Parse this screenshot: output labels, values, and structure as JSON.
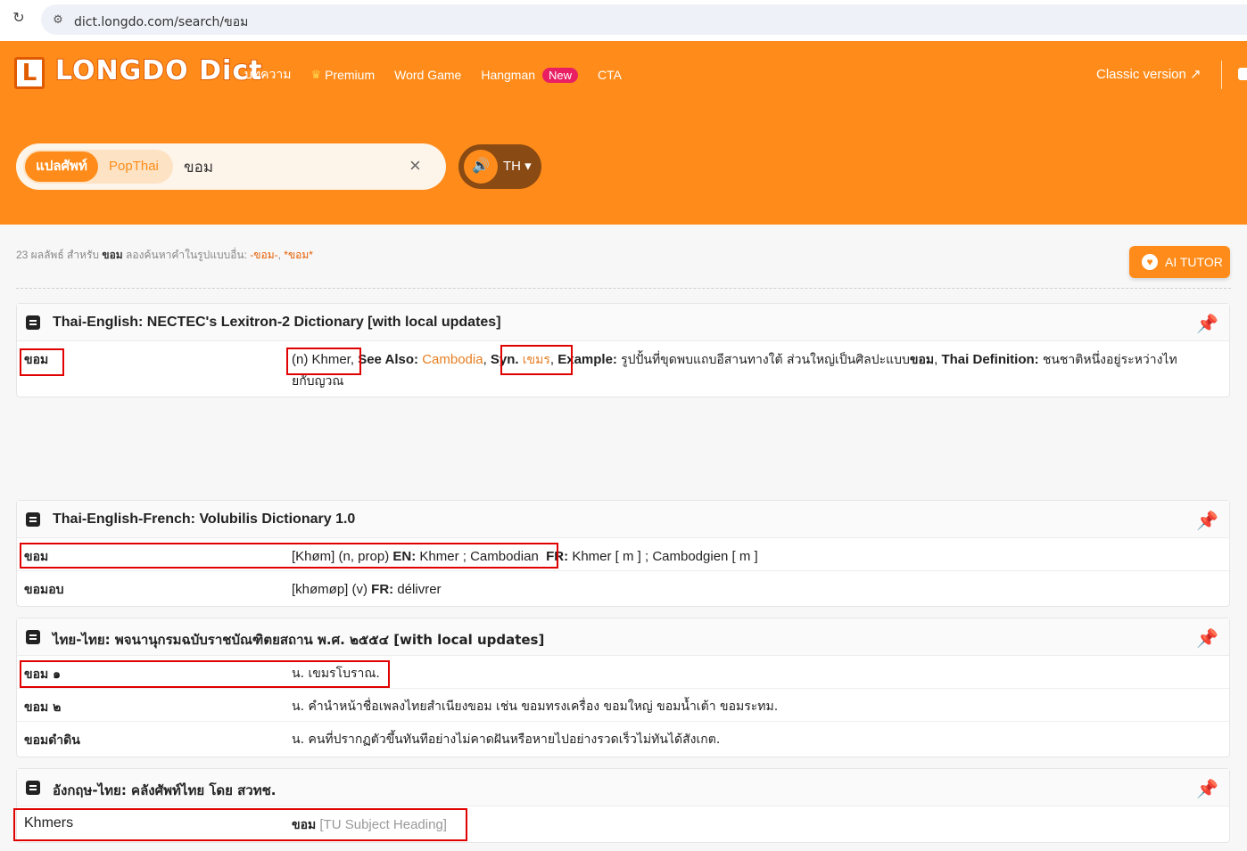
{
  "browser": {
    "url": "dict.longdo.com/search/ขอม"
  },
  "header": {
    "logo_letter": "L",
    "logo_text": "LONGDO Dict",
    "nav": [
      "บทความ",
      "Premium",
      "Word Game",
      "Hangman",
      "CTA"
    ],
    "new_badge": "New",
    "classic": "Classic version ↗"
  },
  "search": {
    "mode_active": "แปลศัพท์",
    "mode_other": "PopThai",
    "query": "ขอม",
    "clear": "×",
    "lang": "TH ▾"
  },
  "summary": {
    "count": "23 ผลลัพธ์ สำหรับ",
    "term": "ขอม",
    "try_text": "ลองค้นหาคำในรูปแบบอื่น:",
    "alt1": "-ขอม-",
    "alt2": "*ขอม*"
  },
  "ai_tutor": "AI TUTOR",
  "cards": [
    {
      "title": "Thai-English: NECTEC's Lexitron-2 Dictionary [with local updates]",
      "rows": [
        {
          "term": "ขอม",
          "pos": "(n) Khmer,",
          "see_also_label": "See Also:",
          "see_also": "Cambodia",
          "syn_label": "Syn.",
          "syn": "เขมร",
          "example_label": "Example:",
          "example": "รูปปั้นที่ขุดพบแถบอีสานทางใต้ ส่วนใหญ่เป็นศิลปะแบบ",
          "example_term": "ขอม",
          "thai_def_label": "Thai Definition:",
          "thai_def": "ชนชาติหนึ่งอยู่ระหว่างไทยกับญวณ"
        }
      ]
    },
    {
      "title": "Thai-English-French: Volubilis Dictionary 1.0",
      "rows": [
        {
          "term": "ขอม",
          "pron": "[Khøm] (n, prop)",
          "en_label": "EN:",
          "en": "Khmer ; Cambodian",
          "fr_label": "FR:",
          "fr": "Khmer [ m ] ; Cambodgien [ m ]"
        },
        {
          "term": "ขอมอบ",
          "pron": "[khømøp] (v)",
          "fr_label": "FR:",
          "fr": "délivrer"
        }
      ]
    },
    {
      "title": "ไทย-ไทย: พจนานุกรมฉบับราชบัณฑิตยสถาน พ.ศ. ๒๕๕๔ [with local updates]",
      "rows": [
        {
          "term": "ขอม ๑",
          "def": "น. เขมรโบราณ."
        },
        {
          "term": "ขอม ๒",
          "def": "น. คำนำหน้าชื่อเพลงไทยสำเนียงขอม เช่น ขอมทรงเครื่อง ขอมใหญ่ ขอมน้ำเต้า ขอมระทม."
        },
        {
          "term": "ขอมดำดิน",
          "def": "น. คนที่ปรากฏตัวขึ้นทันทีอย่างไม่คาดฝันหรือหายไปอย่างรวดเร็วไม่ทันได้สังเกต."
        }
      ]
    },
    {
      "title": "อังกฤษ-ไทย: คลังศัพท์ไทย โดย สวทช.",
      "rows": [
        {
          "term": "Khmers",
          "def_term": "ขอม",
          "def_note": "[TU Subject Heading]"
        }
      ]
    }
  ]
}
